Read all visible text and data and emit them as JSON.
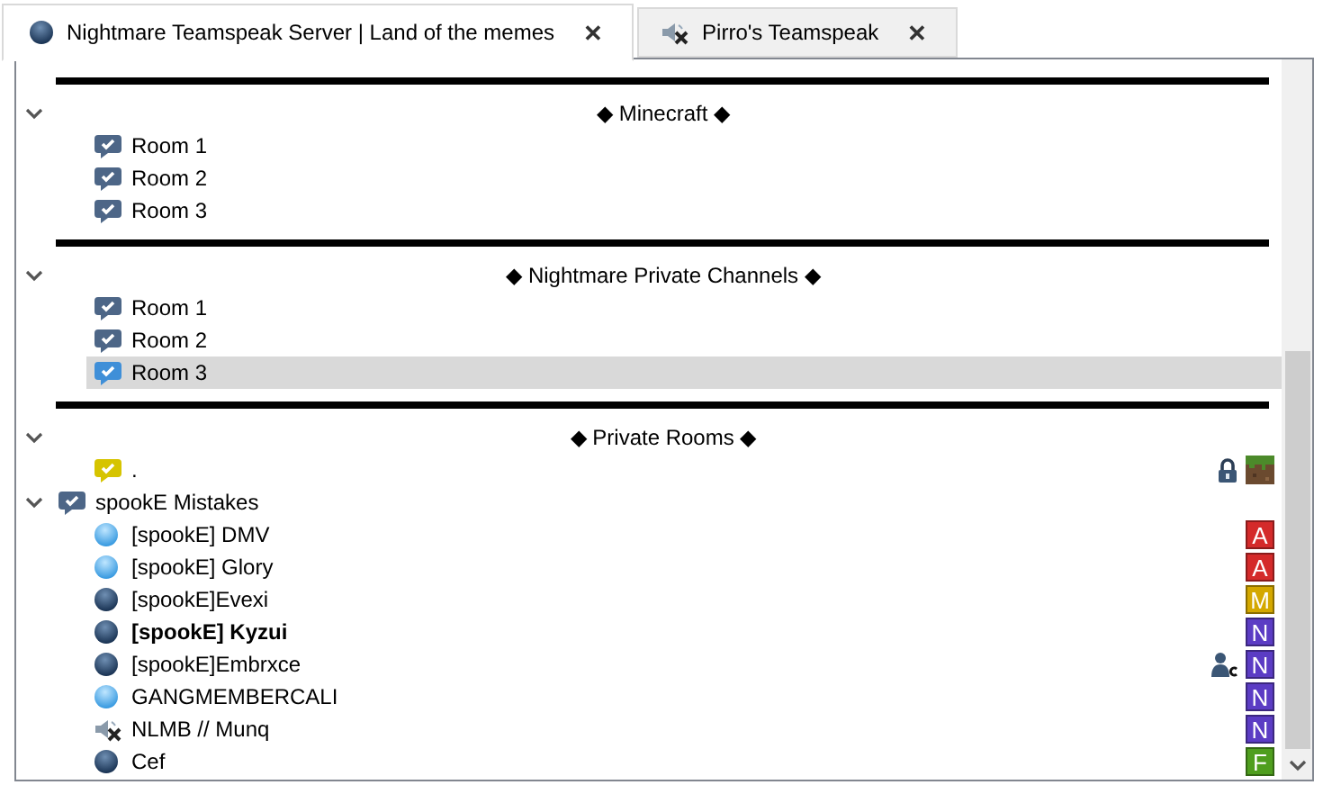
{
  "tabs": [
    {
      "label": "Nightmare Teamspeak Server | Land of the memes",
      "selected": true,
      "kind": "connected",
      "close": "✕"
    },
    {
      "label": "Pirro's Teamspeak",
      "selected": false,
      "kind": "muted",
      "close": "✕"
    }
  ],
  "tree": [
    {
      "kind": "spacer",
      "title": "◆ Minecraft ◆",
      "expanded": true,
      "children": [
        {
          "kind": "channel",
          "name": "Room 1",
          "selected": false
        },
        {
          "kind": "channel",
          "name": "Room 2",
          "selected": false
        },
        {
          "kind": "channel",
          "name": "Room 3",
          "selected": false
        }
      ]
    },
    {
      "kind": "spacer",
      "title": "◆ Nightmare Private Channels ◆",
      "expanded": true,
      "children": [
        {
          "kind": "channel",
          "name": "Room 1",
          "selected": false
        },
        {
          "kind": "channel",
          "name": "Room 2",
          "selected": false
        },
        {
          "kind": "channel",
          "name": "Room 3",
          "selected": true
        }
      ]
    },
    {
      "kind": "spacer",
      "title": "◆ Private Rooms ◆",
      "expanded": true,
      "children": [
        {
          "kind": "channel",
          "name": ".",
          "selected": false,
          "password": true,
          "channel_icon": true
        }
      ]
    },
    {
      "kind": "channel",
      "name": "spookE Mistakes",
      "selected": false,
      "expanded": true,
      "children": [
        {
          "kind": "client",
          "name": "[spookE] DMV",
          "talking": true,
          "muted": false,
          "self": false,
          "commander": false,
          "badge": "A",
          "color": "#d42a2a"
        },
        {
          "kind": "client",
          "name": "[spookE] Glory",
          "talking": true,
          "muted": false,
          "self": false,
          "commander": false,
          "badge": "A",
          "color": "#d42a2a"
        },
        {
          "kind": "client",
          "name": "[spookE]Evexi",
          "talking": false,
          "muted": false,
          "self": false,
          "commander": false,
          "badge": "M",
          "color": "#d4a800"
        },
        {
          "kind": "client",
          "name": "[spookE] Kyzui",
          "talking": false,
          "muted": false,
          "self": true,
          "commander": false,
          "badge": "N",
          "color": "#5b3cc4"
        },
        {
          "kind": "client",
          "name": "[spookE]Embrxce",
          "talking": false,
          "muted": false,
          "self": false,
          "commander": true,
          "badge": "N",
          "color": "#5b3cc4"
        },
        {
          "kind": "client",
          "name": "GANGMEMBERCALI",
          "talking": true,
          "muted": false,
          "self": false,
          "commander": false,
          "badge": "N",
          "color": "#5b3cc4"
        },
        {
          "kind": "client",
          "name": "NLMB // Munq",
          "muted": true,
          "self": false,
          "commander": false,
          "badge": "N",
          "color": "#5b3cc4"
        },
        {
          "kind": "client",
          "name": "Cef",
          "talking": false,
          "muted": false,
          "self": false,
          "commander": false,
          "badge": "F",
          "color": "#4f9e1e"
        }
      ]
    }
  ]
}
